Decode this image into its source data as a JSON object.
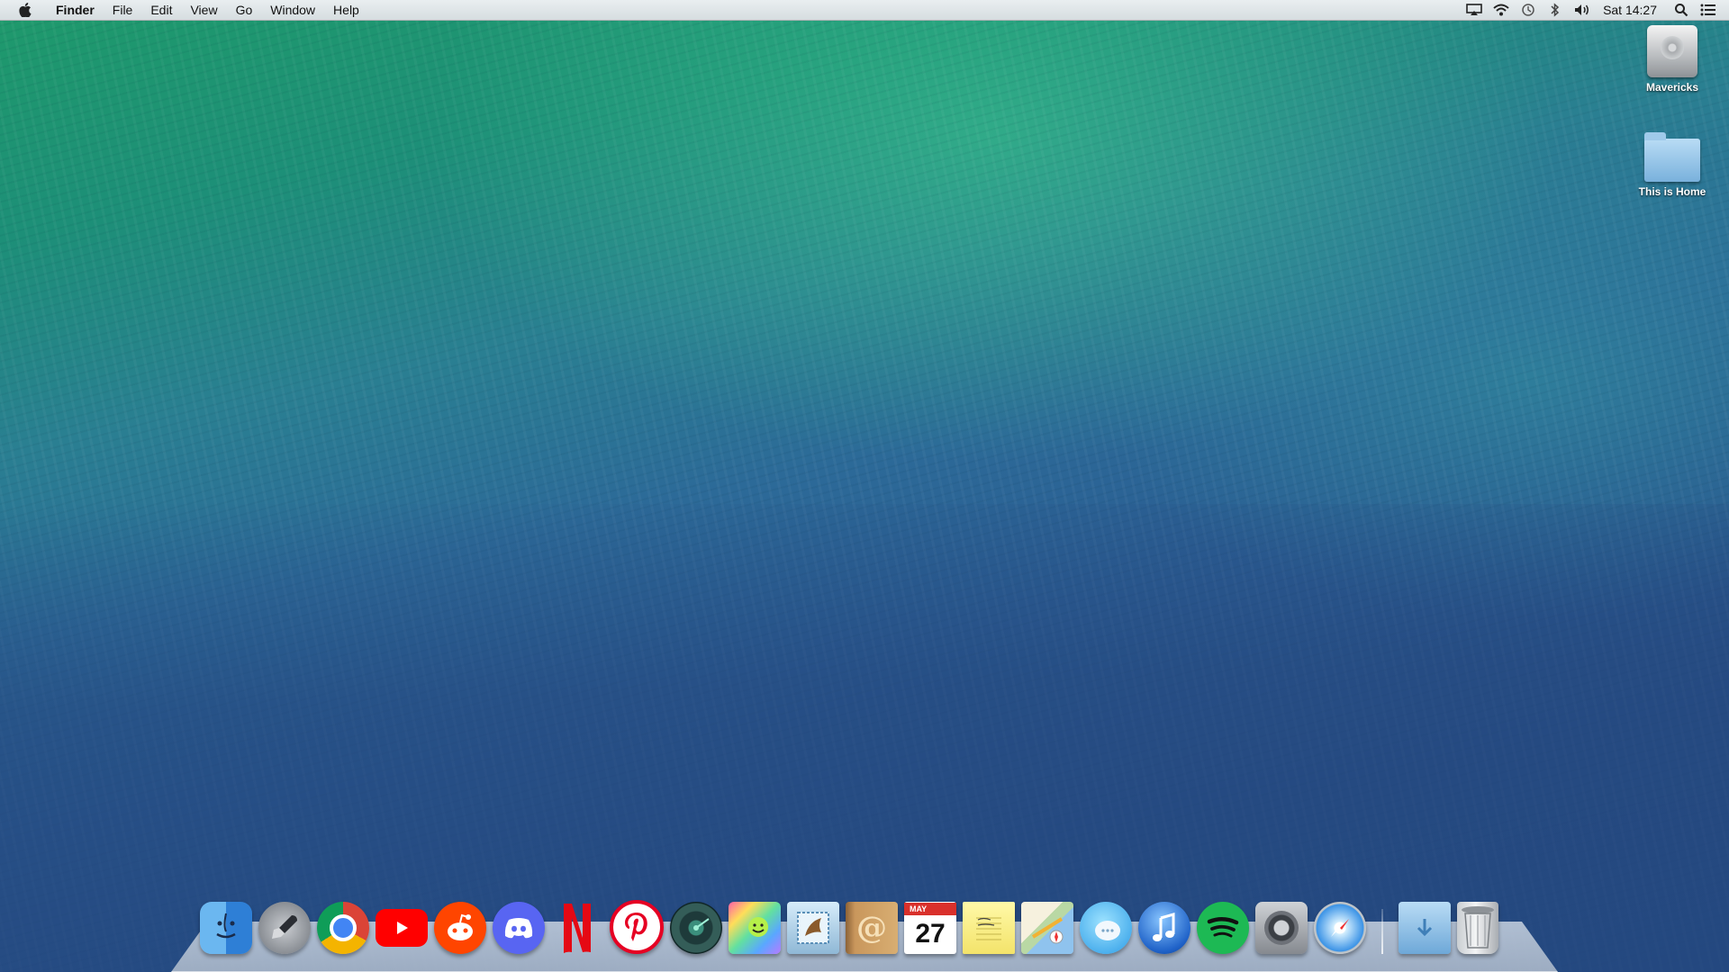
{
  "menubar": {
    "app_name": "Finder",
    "menus": [
      "File",
      "Edit",
      "View",
      "Go",
      "Window",
      "Help"
    ],
    "status_icons": [
      "airplay-icon",
      "wifi-icon",
      "time-machine-icon",
      "bluetooth-icon",
      "volume-icon",
      "spotlight-icon",
      "notification-center-icon"
    ],
    "clock": "Sat 14:27"
  },
  "desktop": {
    "icons": [
      {
        "label": "Mavericks",
        "icon": "hard-drive-icon"
      },
      {
        "label": "This is Home",
        "icon": "folder-icon"
      }
    ]
  },
  "dock": {
    "apps": [
      "finder-icon",
      "launchpad-icon",
      "chrome-icon",
      "youtube-icon",
      "reddit-icon",
      "discord-icon",
      "netflix-icon",
      "pinterest-icon",
      "radar-icon",
      "colors-icon",
      "mail-icon",
      "contacts-icon",
      "calendar-icon",
      "notes-icon",
      "maps-icon",
      "messages-icon",
      "itunes-icon",
      "spotify-icon",
      "system-preferences-icon",
      "safari-icon"
    ],
    "calendar_month": "MAY",
    "calendar_day": "27",
    "contacts_glyph": "@",
    "stacks": [
      "downloads-icon",
      "trash-icon"
    ]
  }
}
